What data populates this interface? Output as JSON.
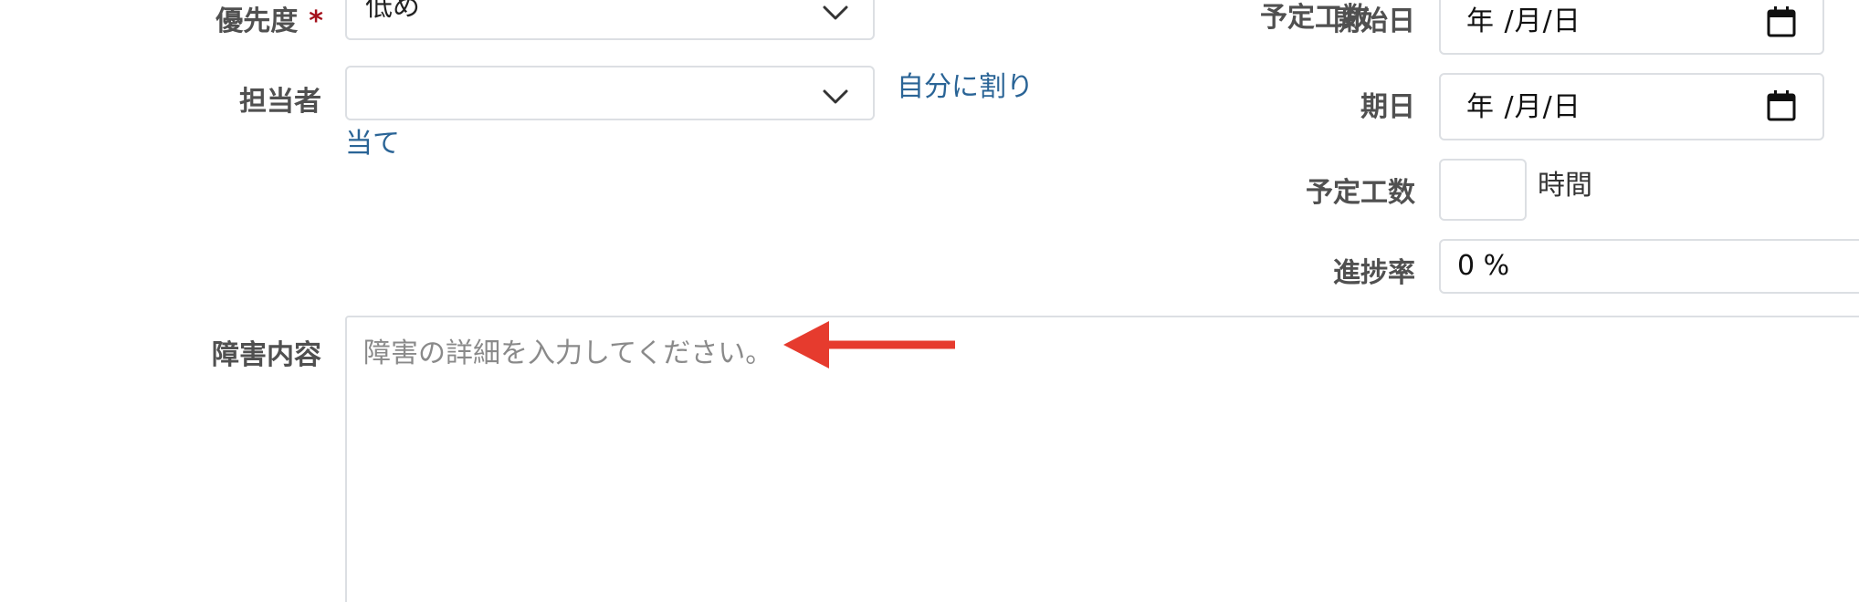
{
  "form": {
    "priority": {
      "label": "優先度",
      "required_mark": "*",
      "value": "低め"
    },
    "assignee": {
      "label": "担当者",
      "value": "",
      "assign_to_me_link": "自分に割り当て",
      "assign_to_me_link_line1": "自分に割り",
      "assign_to_me_link_line2": "当て"
    },
    "start_date": {
      "label": "開始日",
      "value": "年 /月/日"
    },
    "due_date": {
      "label": "期日",
      "value": "年 /月/日"
    },
    "estimated_time": {
      "label": "予定工数",
      "value": "",
      "unit": "時間"
    },
    "done_ratio": {
      "label": "進捗率",
      "value": "0 %"
    },
    "description": {
      "label": "障害内容",
      "placeholder": "障害の詳細を入力してください。"
    }
  },
  "annotation": {
    "arrow_color": "#e63b2e"
  },
  "icons": {
    "dropdown": "chevron-down-icon",
    "date": "calendar-icon"
  },
  "colors": {
    "link": "#2a6496",
    "required": "#a5121d",
    "label": "#505050",
    "border": "#dcdfe3"
  }
}
